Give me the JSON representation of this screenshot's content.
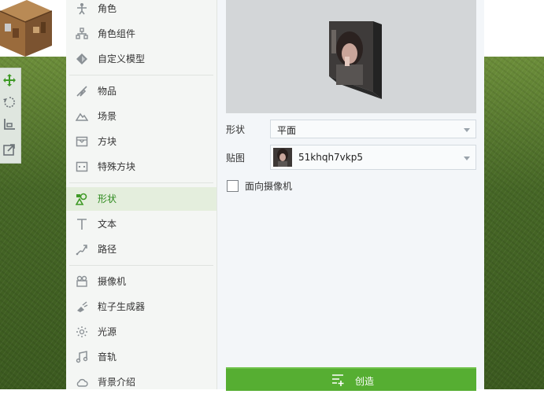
{
  "menu": {
    "items": [
      {
        "label": "角色",
        "icon": "character-icon"
      },
      {
        "label": "角色组件",
        "icon": "component-icon"
      },
      {
        "label": "自定义模型",
        "icon": "custom-model-icon"
      },
      {
        "label": "物品",
        "icon": "item-icon"
      },
      {
        "label": "场景",
        "icon": "scene-icon"
      },
      {
        "label": "方块",
        "icon": "block-icon"
      },
      {
        "label": "特殊方块",
        "icon": "special-block-icon"
      },
      {
        "label": "形状",
        "icon": "shape-icon",
        "active": true
      },
      {
        "label": "文本",
        "icon": "text-icon"
      },
      {
        "label": "路径",
        "icon": "path-icon"
      },
      {
        "label": "摄像机",
        "icon": "camera-icon"
      },
      {
        "label": "粒子生成器",
        "icon": "particle-icon"
      },
      {
        "label": "光源",
        "icon": "light-icon"
      },
      {
        "label": "音轨",
        "icon": "music-icon"
      },
      {
        "label": "背景介绍",
        "icon": "cloud-icon"
      }
    ]
  },
  "panel": {
    "shape_label": "形状",
    "shape_value": "平面",
    "texture_label": "贴图",
    "texture_value": "51khqh7vkp5",
    "face_camera_label": "面向摄像机",
    "face_camera_checked": false,
    "create_label": "创造"
  },
  "toolbar": {
    "tools": [
      "move-icon",
      "rotate-icon",
      "scale-icon",
      "export-icon"
    ]
  },
  "colors": {
    "accent": "#56ae32",
    "active_text": "#2d8a1d",
    "active_bg": "#e4eedd"
  }
}
